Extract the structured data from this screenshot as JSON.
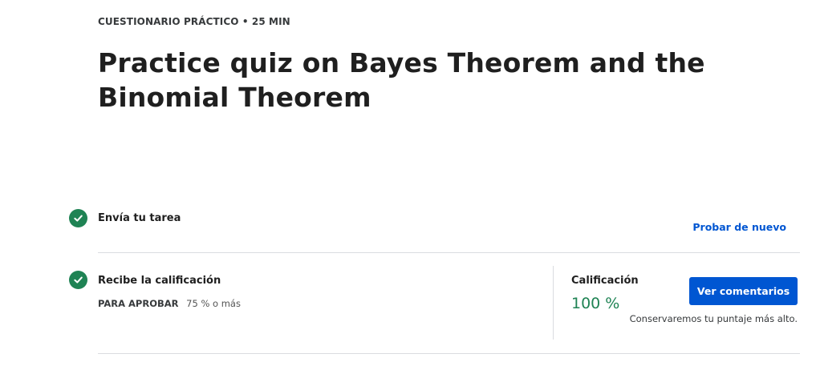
{
  "header": {
    "eyebrow": "CUESTIONARIO PRÁCTICO • 25 MIN",
    "title": "Practice quiz on Bayes Theorem and the Binomial Theorem"
  },
  "steps": [
    {
      "label": "Envía tu tarea",
      "status_icon": "check-circle-icon",
      "action_label": "Probar de nuevo"
    },
    {
      "label": "Recibe la calificación",
      "status_icon": "check-circle-icon",
      "pass_label": "PARA APROBAR",
      "pass_value": "75 % o más"
    }
  ],
  "grade": {
    "label": "Calificación",
    "value": "100 %",
    "button_label": "Ver comentarios",
    "note": "Conservaremos tu puntaje más alto."
  },
  "colors": {
    "success": "#1f8354",
    "accent": "#0056d2",
    "divider": "#dadce0",
    "text": "#1f1f1f"
  }
}
